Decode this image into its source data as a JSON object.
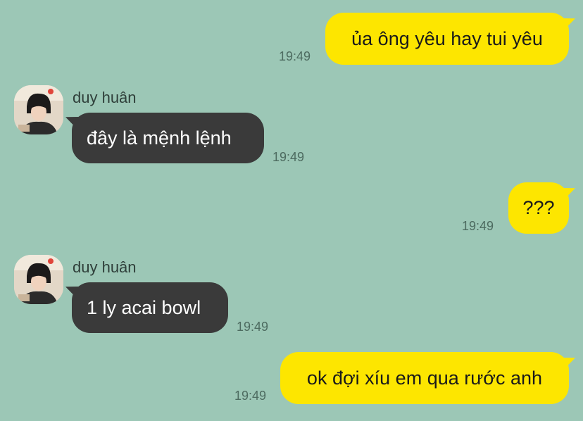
{
  "contact": {
    "name": "duy huân"
  },
  "messages": [
    {
      "direction": "out",
      "text": "ủa ông yêu hay tui yêu",
      "time": "19:49"
    },
    {
      "direction": "in",
      "sender": "duy huân",
      "text": "đây là mệnh lệnh",
      "time": "19:49"
    },
    {
      "direction": "out",
      "text": "???",
      "time": "19:49"
    },
    {
      "direction": "in",
      "sender": "duy huân",
      "text": "1 ly acai bowl",
      "time": "19:49"
    },
    {
      "direction": "out",
      "text": "ok đợi xíu em qua rước anh",
      "time": "19:49"
    }
  ],
  "colors": {
    "background": "#9cc7b6",
    "outgoing_bubble": "#fde600",
    "incoming_bubble": "#3a3a3a"
  }
}
